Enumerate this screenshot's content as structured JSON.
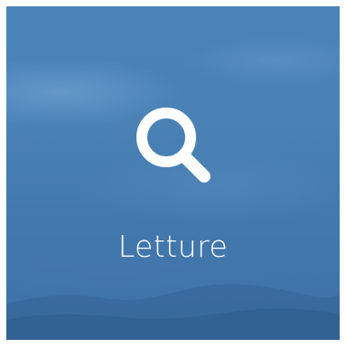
{
  "tile": {
    "label": "Letture",
    "icon": "search-icon",
    "accent_color": "#4a83b8"
  }
}
